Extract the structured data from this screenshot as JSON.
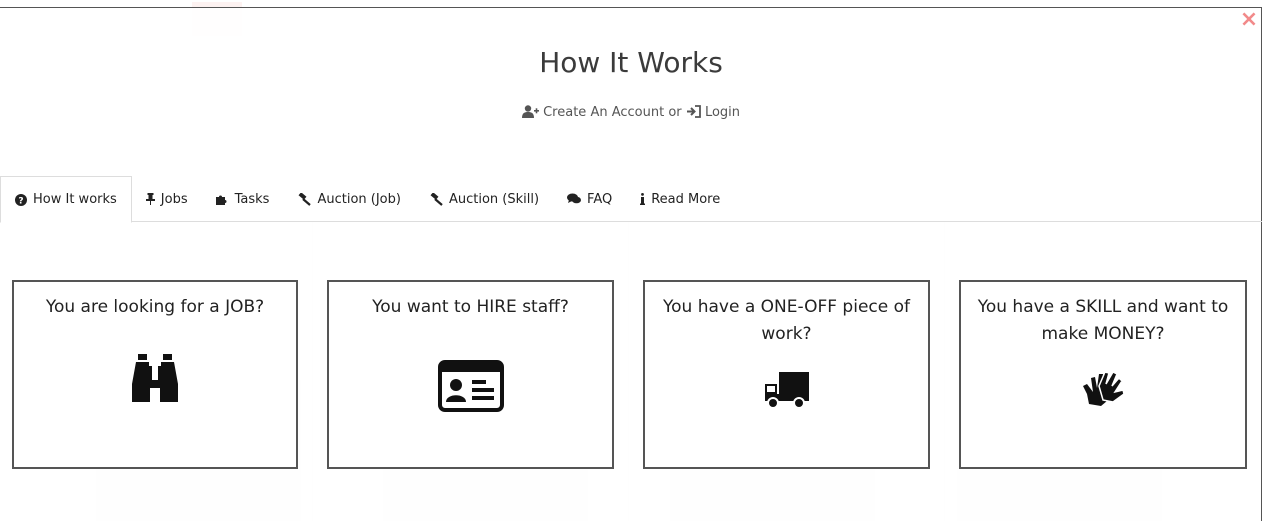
{
  "modal": {
    "title": "How It Works",
    "create_account": "Create An Account",
    "or": "or",
    "login": "Login",
    "close": "×"
  },
  "tabs": [
    {
      "label": "How It works",
      "icon": "question-circle-icon",
      "active": true
    },
    {
      "label": "Jobs",
      "icon": "thumbtack-icon",
      "active": false
    },
    {
      "label": "Tasks",
      "icon": "puzzle-icon",
      "active": false
    },
    {
      "label": "Auction (Job)",
      "icon": "gavel-icon",
      "active": false
    },
    {
      "label": "Auction (Skill)",
      "icon": "gavel-icon",
      "active": false
    },
    {
      "label": "FAQ",
      "icon": "comments-icon",
      "active": false
    },
    {
      "label": "Read More",
      "icon": "info-icon",
      "active": false
    }
  ],
  "cards": [
    {
      "title": "You are looking for a JOB?",
      "icon": "binoculars-icon"
    },
    {
      "title": "You want to HIRE staff?",
      "icon": "id-card-icon"
    },
    {
      "title": "You have a ONE-OFF piece of work?",
      "icon": "truck-icon"
    },
    {
      "title": "You have a SKILL and want to make MONEY?",
      "icon": "sign-language-icon"
    }
  ],
  "colors": {
    "close": "#f28a8a",
    "text": "#222222",
    "card_border": "#555555"
  }
}
